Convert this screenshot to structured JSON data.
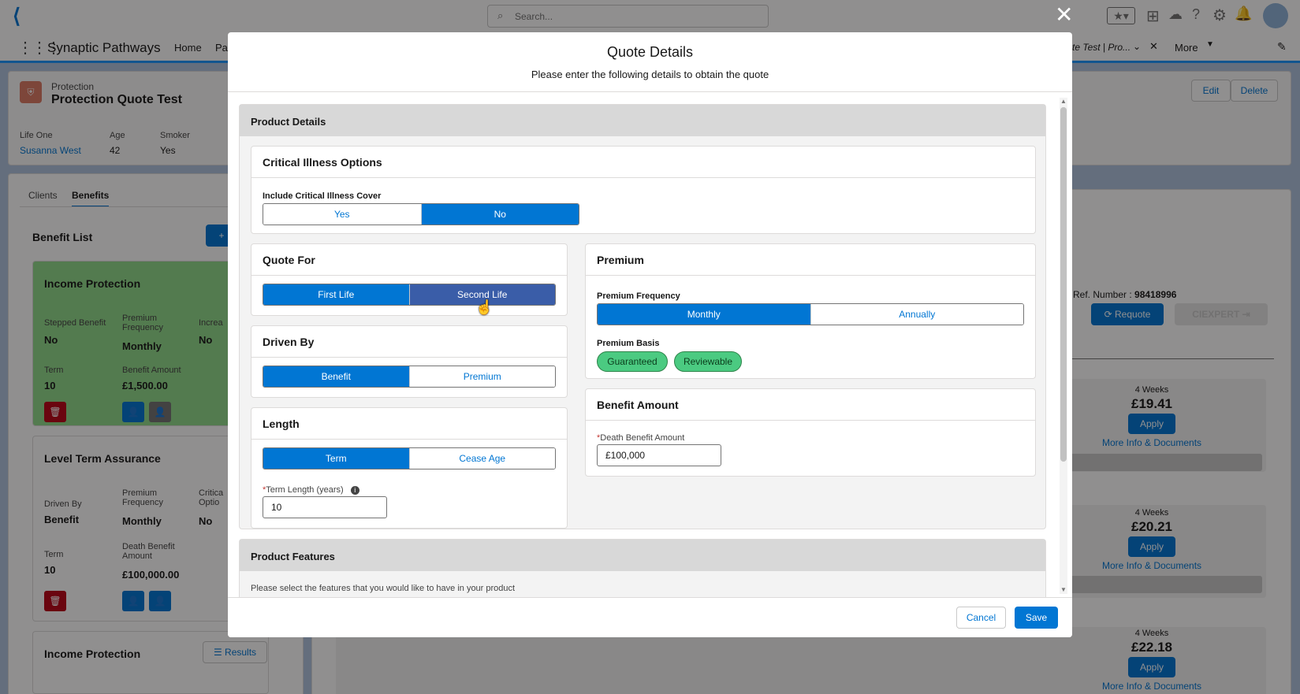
{
  "app": {
    "name": "Synaptic Pathways",
    "search_placeholder": "Search...",
    "nav": {
      "home": "Home",
      "partial": "Par",
      "tab_title": "te Test | Pro...",
      "more": "More"
    }
  },
  "record": {
    "type": "Protection",
    "title": "Protection Quote Test",
    "edit": "Edit",
    "delete": "Delete",
    "fields": [
      {
        "label": "Life One",
        "value": "Susanna West"
      },
      {
        "label": "Age",
        "value": "42"
      },
      {
        "label": "Smoker",
        "value": "Yes"
      }
    ]
  },
  "left": {
    "tabs": [
      "Clients",
      "Benefits"
    ],
    "benefit_list": "Benefit List",
    "cards": [
      {
        "title": "Income Protection",
        "f1l": "Stepped Benefit",
        "f1v": "No",
        "f2l": "Premium Frequency",
        "f2v": "Monthly",
        "f3l": "Increa",
        "f3v": "No",
        "f4l": "Term",
        "f4v": "10",
        "f5l": "Benefit Amount",
        "f5v": "£1,500.00"
      },
      {
        "title": "Level Term Assurance",
        "f1l": "Driven By",
        "f1v": "Benefit",
        "f2l": "Premium Frequency",
        "f2v": "Monthly",
        "f3l": "Critica Optio",
        "f3v": "No",
        "f4l": "Term",
        "f4v": "10",
        "f5l": "Death Benefit Amount",
        "f5v": "£100,000.00"
      },
      {
        "title": "Income Protection",
        "results": "Results"
      }
    ]
  },
  "right": {
    "ref_label": "e Ref. Number : ",
    "ref_value": "98418996",
    "requote": "Requote",
    "ciexpert": "CIEXPERT",
    "quotes": [
      {
        "period": "4 Weeks",
        "price": "£19.41",
        "apply": "Apply",
        "more": "More Info & Documents"
      },
      {
        "period": "4 Weeks",
        "price": "£20.21",
        "apply": "Apply",
        "more": "More Info & Documents"
      },
      {
        "period": "4 Weeks",
        "price": "£22.18",
        "apply": "Apply",
        "more": "More Info & Documents"
      }
    ]
  },
  "modal": {
    "title": "Quote Details",
    "subtitle": "Please enter the following details to obtain the quote",
    "product_details": "Product Details",
    "ci": {
      "title": "Critical Illness Options",
      "label": "Include Critical Illness Cover",
      "yes": "Yes",
      "no": "No"
    },
    "quote_for": {
      "title": "Quote For",
      "first": "First Life",
      "second": "Second Life"
    },
    "driven_by": {
      "title": "Driven By",
      "benefit": "Benefit",
      "premium": "Premium"
    },
    "length": {
      "title": "Length",
      "term": "Term",
      "cease": "Cease Age",
      "term_label": "Term Length (years)",
      "term_value": "10"
    },
    "premium": {
      "title": "Premium",
      "freq_label": "Premium Frequency",
      "monthly": "Monthly",
      "annually": "Annually",
      "basis_label": "Premium Basis",
      "guaranteed": "Guaranteed",
      "reviewable": "Reviewable"
    },
    "benefit_amount": {
      "title": "Benefit Amount",
      "label": "Death Benefit Amount",
      "value": "£100,000"
    },
    "product_features": "Product Features",
    "features_hint": "Please select the features that you would like to have in your product",
    "cancel": "Cancel",
    "save": "Save"
  }
}
